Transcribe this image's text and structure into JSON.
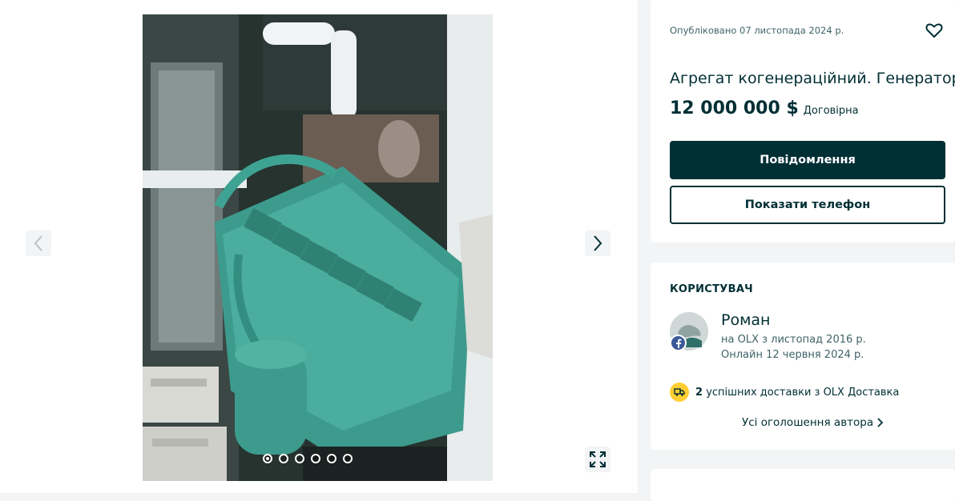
{
  "gallery": {
    "photo_alt": "",
    "dots_count": 6,
    "active_dot": 0
  },
  "listing": {
    "published": "Опубліковано 07 листопада 2024 р.",
    "title": "Агрегат когенераційний. Генератор",
    "price": "12 000 000 $",
    "negotiable": "Договірна",
    "message_button": "Повідомлення",
    "phone_button": "Показати телефон"
  },
  "user": {
    "heading": "КОРИСТУВАЧ",
    "name": "Роман",
    "since": "на OLX з листопад 2016 р.",
    "online": "Онлайн 12 червня 2024 р.",
    "delivery_count": "2",
    "delivery_text": "успішних доставки з OLX Доставка",
    "all_ads": "Усі оголошення автора"
  },
  "colors": {
    "brand_dark": "#002f34",
    "delivery_badge": "#ffce32",
    "facebook": "#3b5998"
  }
}
